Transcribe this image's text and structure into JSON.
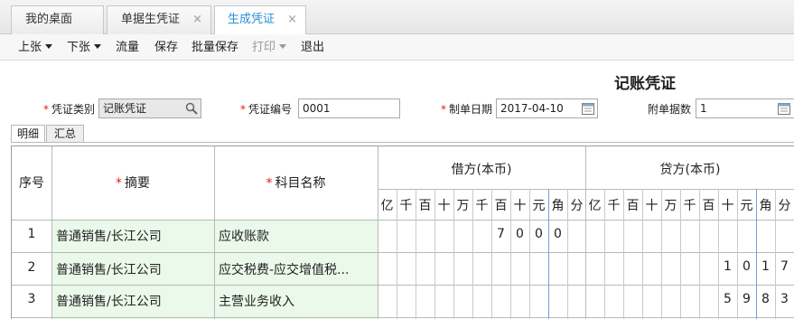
{
  "tabs": [
    {
      "label": "我的桌面",
      "closable": false
    },
    {
      "label": "单据生凭证",
      "closable": true
    },
    {
      "label": "生成凭证",
      "closable": true,
      "active": true
    }
  ],
  "tab_close_glyph": "×",
  "toolbar": {
    "prev": "上张",
    "next": "下张",
    "flow": "流量",
    "save": "保存",
    "batch_save": "批量保存",
    "print": "打印",
    "exit": "退出"
  },
  "document": {
    "title": "记账凭证",
    "required_mark": "*",
    "fields": {
      "voucher_type_label": "凭证类别",
      "voucher_type_value": "记账凭证",
      "voucher_no_label": "凭证编号",
      "voucher_no_value": "0001",
      "date_label": "制单日期",
      "date_value": "2017-04-10",
      "attachments_label": "附单据数",
      "attachments_value": "1"
    }
  },
  "subtabs": [
    "明细",
    "汇总"
  ],
  "table": {
    "headers": {
      "seq": "序号",
      "summary": "摘要",
      "account": "科目名称",
      "debit": "借方(本币)",
      "credit": "贷方(本币)"
    },
    "digit_headers": [
      "亿",
      "千",
      "百",
      "十",
      "万",
      "千",
      "百",
      "十",
      "元",
      "角",
      "分"
    ],
    "rows": [
      {
        "seq": "1",
        "summary": "普通销售/长江公司",
        "account": "应收账款",
        "debit_digits": [
          "",
          "",
          "",
          "",
          "",
          "",
          "7",
          "0",
          "0",
          "0",
          ""
        ],
        "credit_digits": [
          "",
          "",
          "",
          "",
          "",
          "",
          "",
          "",
          "",
          "",
          ""
        ]
      },
      {
        "seq": "2",
        "summary": "普通销售/长江公司",
        "account": "应交税费-应交增值税...",
        "debit_digits": [
          "",
          "",
          "",
          "",
          "",
          "",
          "",
          "",
          "",
          "",
          ""
        ],
        "credit_digits": [
          "",
          "",
          "",
          "",
          "",
          "",
          "",
          "1",
          "0",
          "1",
          "7"
        ]
      },
      {
        "seq": "3",
        "summary": "普通销售/长江公司",
        "account": "主营业务收入",
        "debit_digits": [
          "",
          "",
          "",
          "",
          "",
          "",
          "",
          "",
          "",
          "",
          ""
        ],
        "credit_digits": [
          "",
          "",
          "",
          "",
          "",
          "",
          "",
          "5",
          "9",
          "8",
          "3"
        ]
      }
    ]
  },
  "colors": {
    "accent": "#2a8fd6",
    "required": "#e02020",
    "row_highlight": "#eaf9ea",
    "grid_line": "#b9b9b9",
    "yuan_divider": "#7a9fd0"
  }
}
